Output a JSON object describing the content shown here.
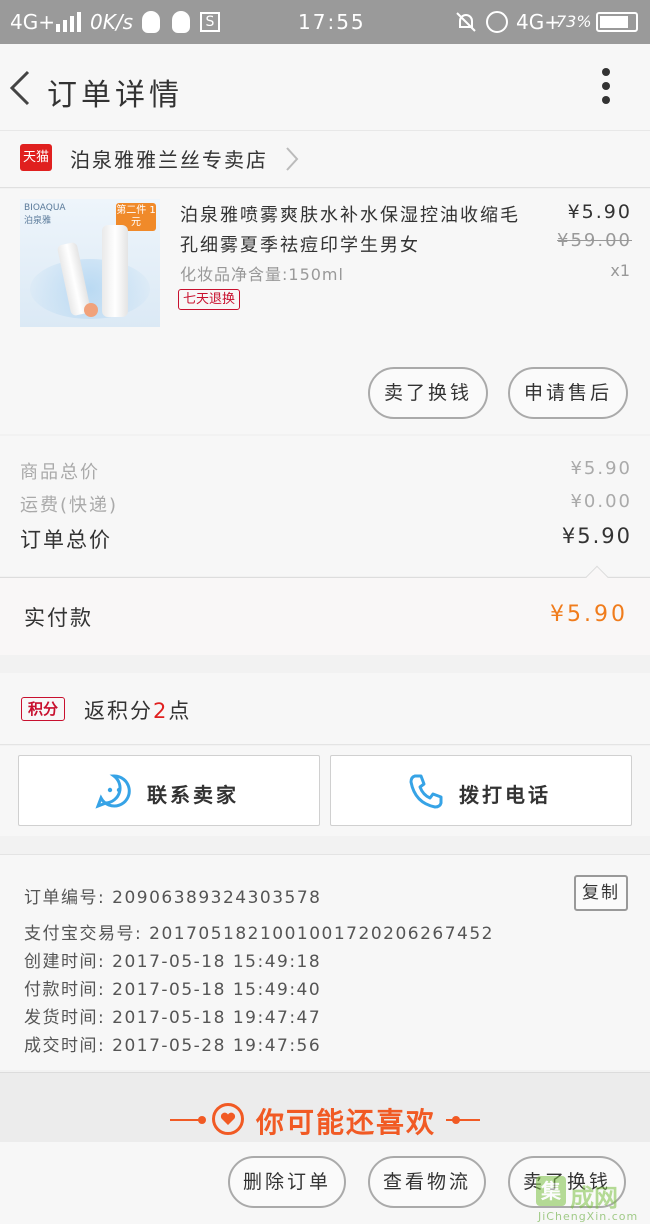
{
  "status_bar": {
    "network_left": "4G+",
    "speed": "0K/s",
    "s_icon": "S",
    "time": "17:55",
    "network_right": "4G+",
    "battery": "73%",
    "icons": [
      "signal-icon",
      "qq-icon",
      "qq-icon",
      "s-app-icon",
      "mute-icon",
      "alarm-icon",
      "battery-icon"
    ]
  },
  "header": {
    "title": "订单详情",
    "icons": [
      "back-icon",
      "more-icon"
    ]
  },
  "shop": {
    "badge": "天猫",
    "name": "泊泉雅雅兰丝专卖店",
    "icon": "chevron-right-icon"
  },
  "product": {
    "image": {
      "brand": "BIOAQUA",
      "brand_cn": "泊泉雅",
      "promo": "第二件 1元"
    },
    "title": "泊泉雅喷雾爽肤水补水保湿控油收缩毛孔细雾夏季祛痘印学生男女",
    "spec": "化妆品净含量:150ml",
    "tag": "七天退换",
    "price": "¥5.90",
    "original_price": "¥59.00",
    "quantity": "x1"
  },
  "actions_top": {
    "sell_label": "卖了换钱",
    "after_sale_label": "申请售后"
  },
  "summary": {
    "items_total_label": "商品总价",
    "items_total_value": "¥5.90",
    "shipping_label": "运费(快递)",
    "shipping_value": "¥0.00",
    "order_total_label": "订单总价",
    "order_total_value": "¥5.90",
    "paid_label": "实付款",
    "paid_value": "¥5.90"
  },
  "points": {
    "badge": "积分",
    "text_before": "返积分",
    "value": "2",
    "text_after": "点"
  },
  "contact": {
    "seller_label": "联系卖家",
    "phone_label": "拨打电话",
    "icons": [
      "chat-icon",
      "phone-icon"
    ]
  },
  "order_info": {
    "copy_label": "复制",
    "lines": [
      "订单编号: 2090638932430357​8",
      "支付宝交易号: 2017051821001001720206267452",
      "创建时间: 2017-05-18  15:49:18",
      "付款时间: 2017-05-18  15:49:40",
      "发货时间: 2017-05-18  19:47:47",
      "成交时间: 2017-05-28  19:47:56"
    ]
  },
  "recommend": {
    "title": "你可能还喜欢",
    "icon": "heart-icon"
  },
  "bottom_actions": {
    "delete_label": "删除订单",
    "logistics_label": "查看物流",
    "sell_label": "卖了换钱"
  },
  "watermark": {
    "logo": "集",
    "text": "成网",
    "url": "JiChengXin.com"
  },
  "colors": {
    "accent_orange": "#f07c1c",
    "tmall_red": "#e0201f",
    "recommend_orange": "#f15a24",
    "contact_blue": "#36a3e6"
  }
}
